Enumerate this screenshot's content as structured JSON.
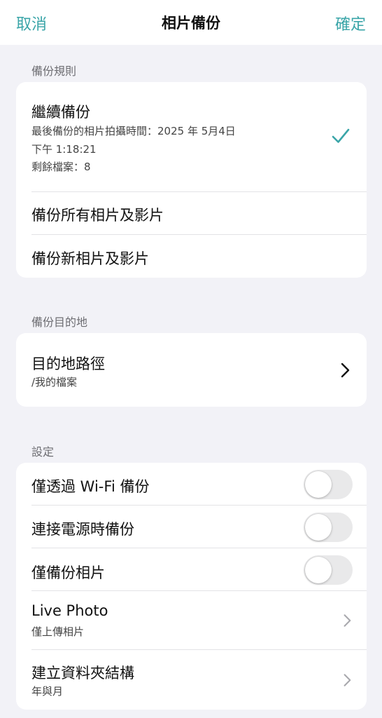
{
  "nav": {
    "cancel_label": "取消",
    "title": "相片備份",
    "confirm_label": "確定"
  },
  "sections": {
    "rules": {
      "header": "備份規則",
      "continue_backup": {
        "title": "繼續備份",
        "sub_line1": "最後備份的相片拍攝時間：2025 年 5月4日",
        "sub_line2": "下午 1:18:21",
        "sub_line3": "剩餘檔案：8",
        "selected": true
      },
      "backup_all": {
        "title": "備份所有相片及影片"
      },
      "backup_new": {
        "title": "備份新相片及影片"
      }
    },
    "destination": {
      "header": "備份目的地",
      "path": {
        "title": "目的地路徑",
        "value": "/我的檔案"
      }
    },
    "settings": {
      "header": "設定",
      "wifi_only": {
        "title": "僅透過 Wi-Fi 備份",
        "enabled": false
      },
      "power_only": {
        "title": "連接電源時備份",
        "enabled": false
      },
      "photos_only": {
        "title": "僅備份相片",
        "enabled": false
      },
      "live_photo": {
        "title": "Live Photo",
        "value": "僅上傳相片"
      },
      "folder_structure": {
        "title": "建立資料夾結構",
        "value": "年與月"
      }
    }
  },
  "colors": {
    "accent": "#3aa5a8",
    "background": "#f2f2f7",
    "card": "#ffffff",
    "toggle_off": "#e9e9ea"
  },
  "icons": {
    "selected_mark": "checkmark-icon",
    "destination_chevron": "chevron-right-icon",
    "row_chevron": "chevron-right-icon"
  }
}
